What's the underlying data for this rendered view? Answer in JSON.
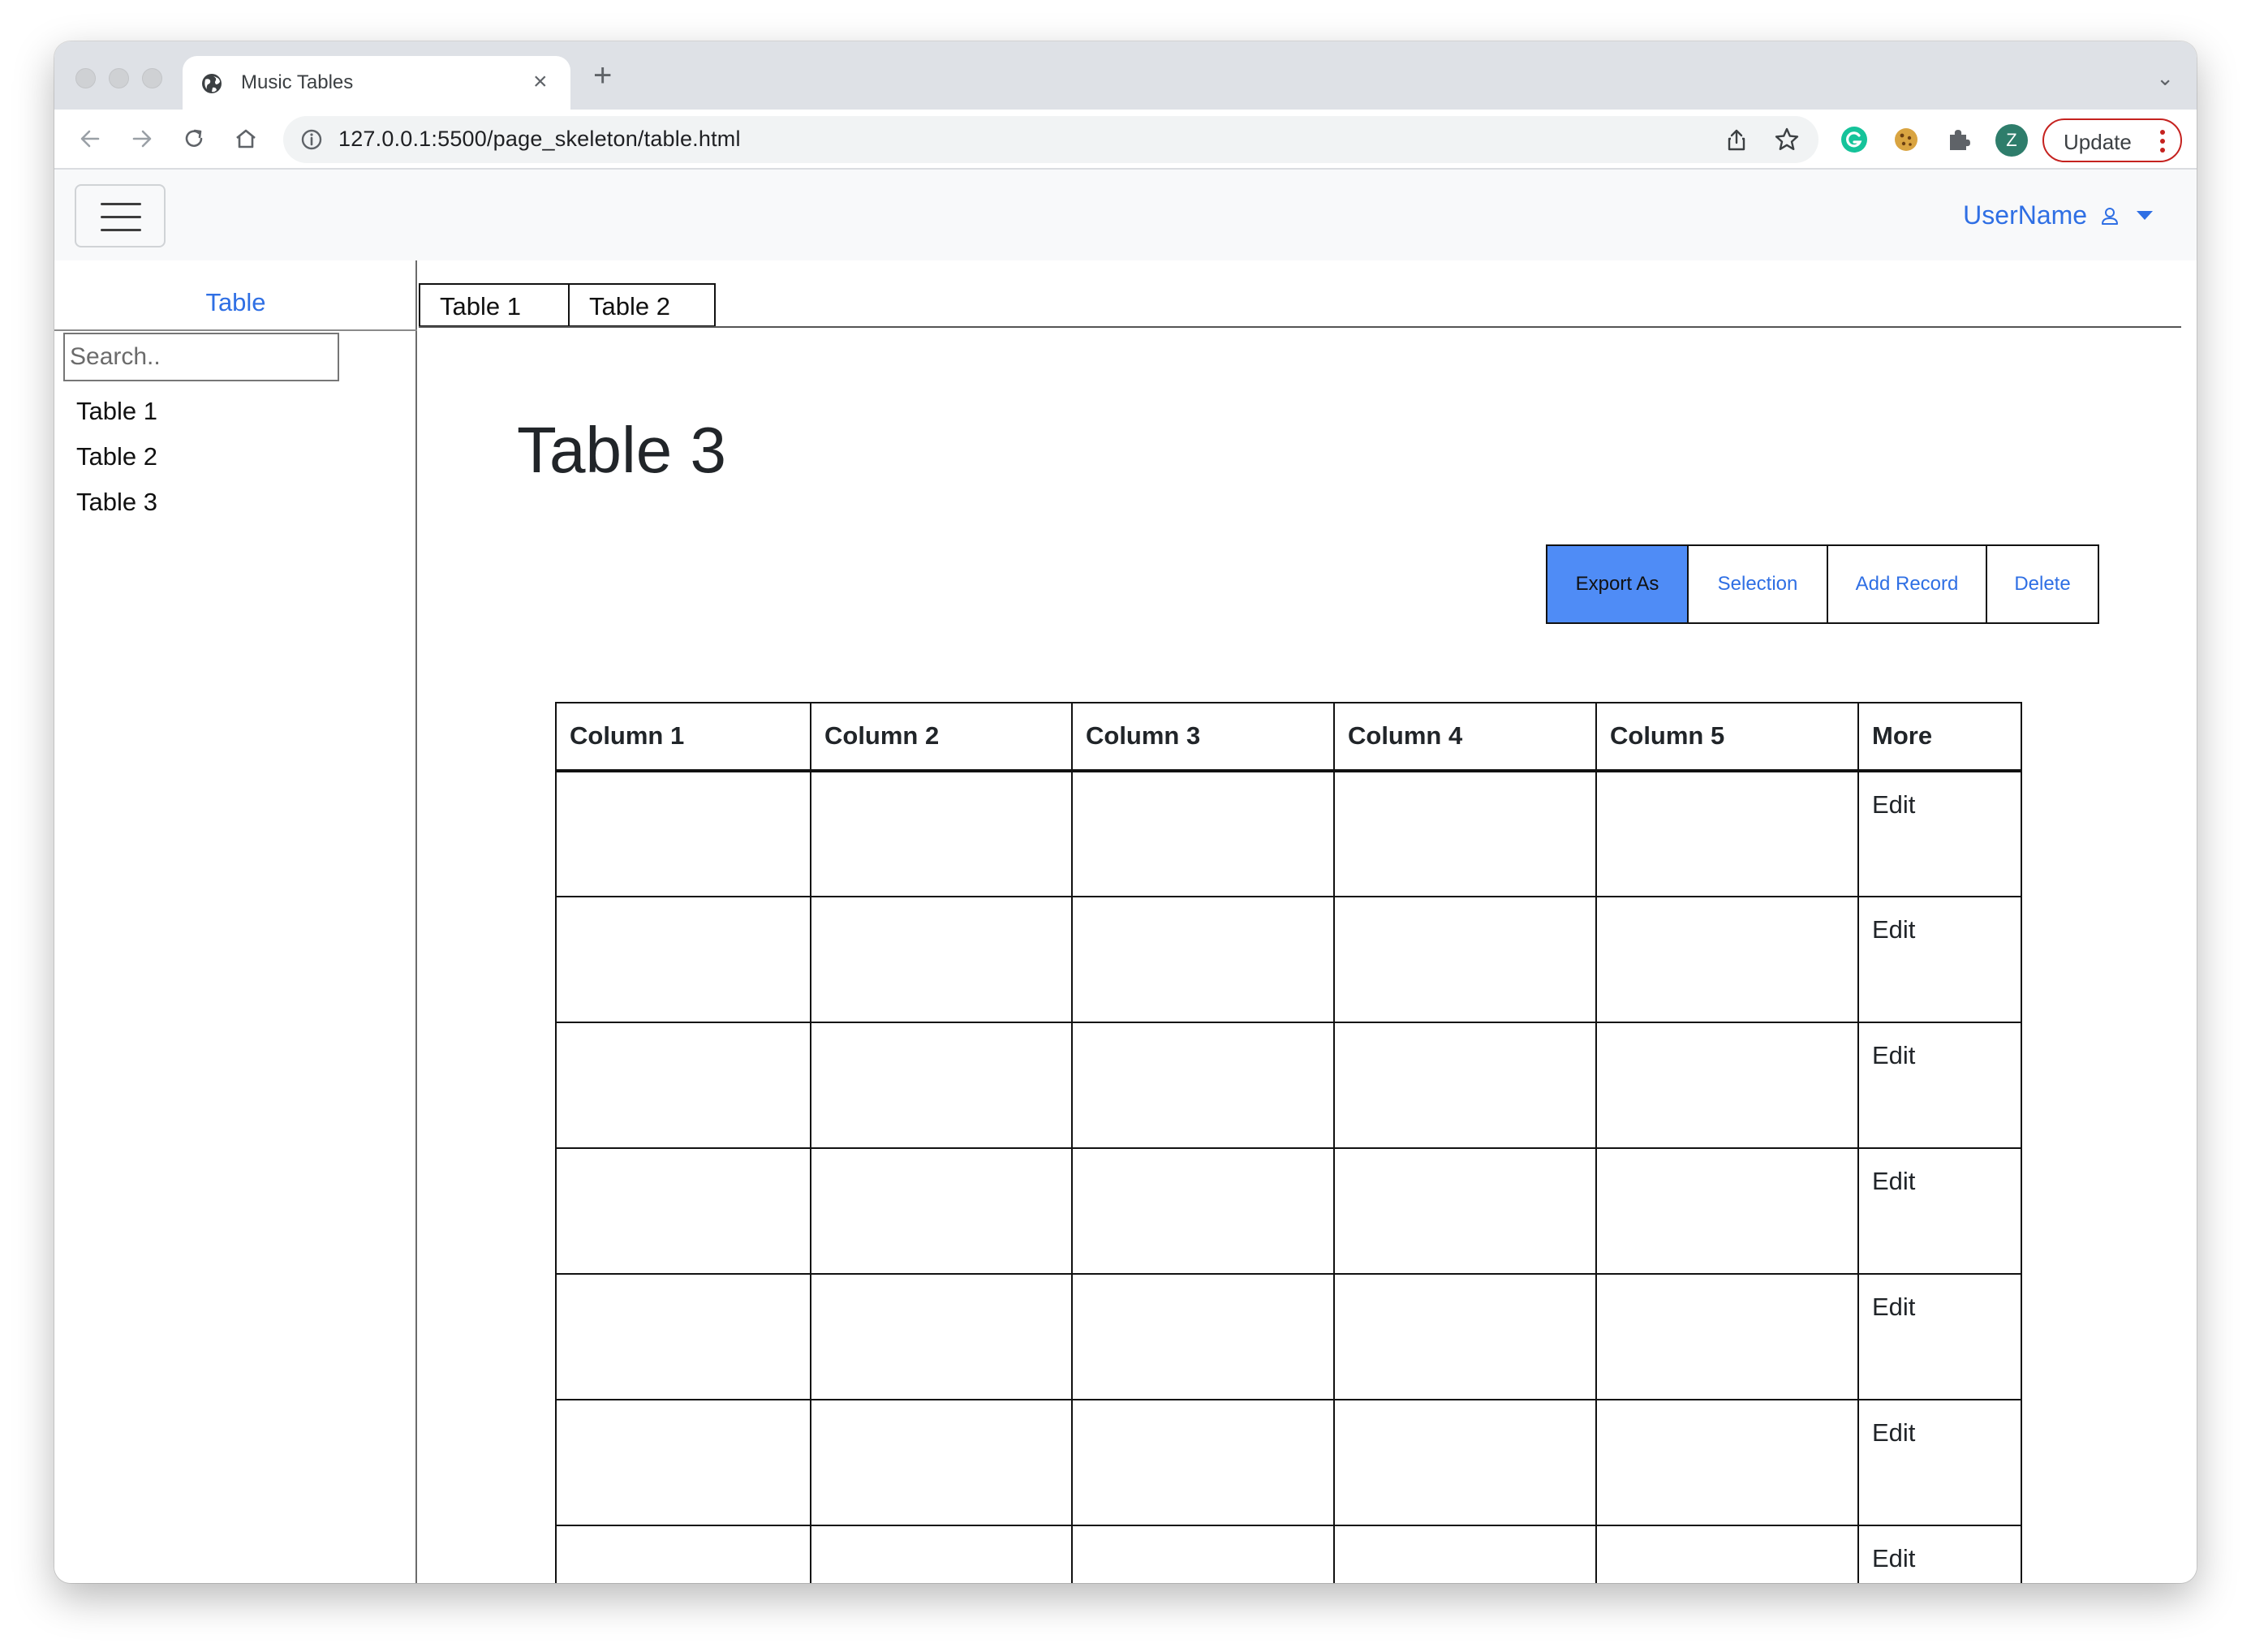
{
  "browser": {
    "tab_title": "Music Tables",
    "tab_close": "×",
    "new_tab": "+",
    "tab_menu": "⌄",
    "url": "127.0.0.1:5500/page_skeleton/table.html",
    "profile_initial": "Z",
    "update_label": "Update"
  },
  "navbar": {
    "user_name": "UserName"
  },
  "sidebar": {
    "title": "Table",
    "search_placeholder": "Search..",
    "items": [
      {
        "label": "Table 1"
      },
      {
        "label": "Table 2"
      },
      {
        "label": "Table 3"
      }
    ]
  },
  "content_tabs": [
    {
      "label": "Table 1"
    },
    {
      "label": "Table 2"
    }
  ],
  "main": {
    "title": "Table 3",
    "actions": {
      "export": "Export As",
      "selection": "Selection",
      "add_record": "Add Record",
      "delete": "Delete"
    },
    "table": {
      "headers": [
        "Column 1",
        "Column 2",
        "Column 3",
        "Column 4",
        "Column 5",
        "More"
      ],
      "rows": [
        {
          "cells": [
            "",
            "",
            "",
            "",
            ""
          ],
          "action": "Edit"
        },
        {
          "cells": [
            "",
            "",
            "",
            "",
            ""
          ],
          "action": "Edit"
        },
        {
          "cells": [
            "",
            "",
            "",
            "",
            ""
          ],
          "action": "Edit"
        },
        {
          "cells": [
            "",
            "",
            "",
            "",
            ""
          ],
          "action": "Edit"
        },
        {
          "cells": [
            "",
            "",
            "",
            "",
            ""
          ],
          "action": "Edit"
        },
        {
          "cells": [
            "",
            "",
            "",
            "",
            ""
          ],
          "action": "Edit"
        },
        {
          "cells": [
            "",
            "",
            "",
            "",
            ""
          ],
          "action": "Edit"
        }
      ]
    }
  },
  "colors": {
    "accent_link": "#2f6fe4",
    "primary_button": "#4f8cf6",
    "update_border": "#c5221f"
  },
  "icons": [
    "globe-icon",
    "back-arrow-icon",
    "forward-arrow-icon",
    "reload-icon",
    "home-icon",
    "info-icon",
    "share-icon",
    "star-icon",
    "grammarly-icon",
    "cookie-icon",
    "puzzle-icon",
    "menu-dots-icon",
    "hamburger-icon",
    "user-icon",
    "caret-down-icon"
  ]
}
